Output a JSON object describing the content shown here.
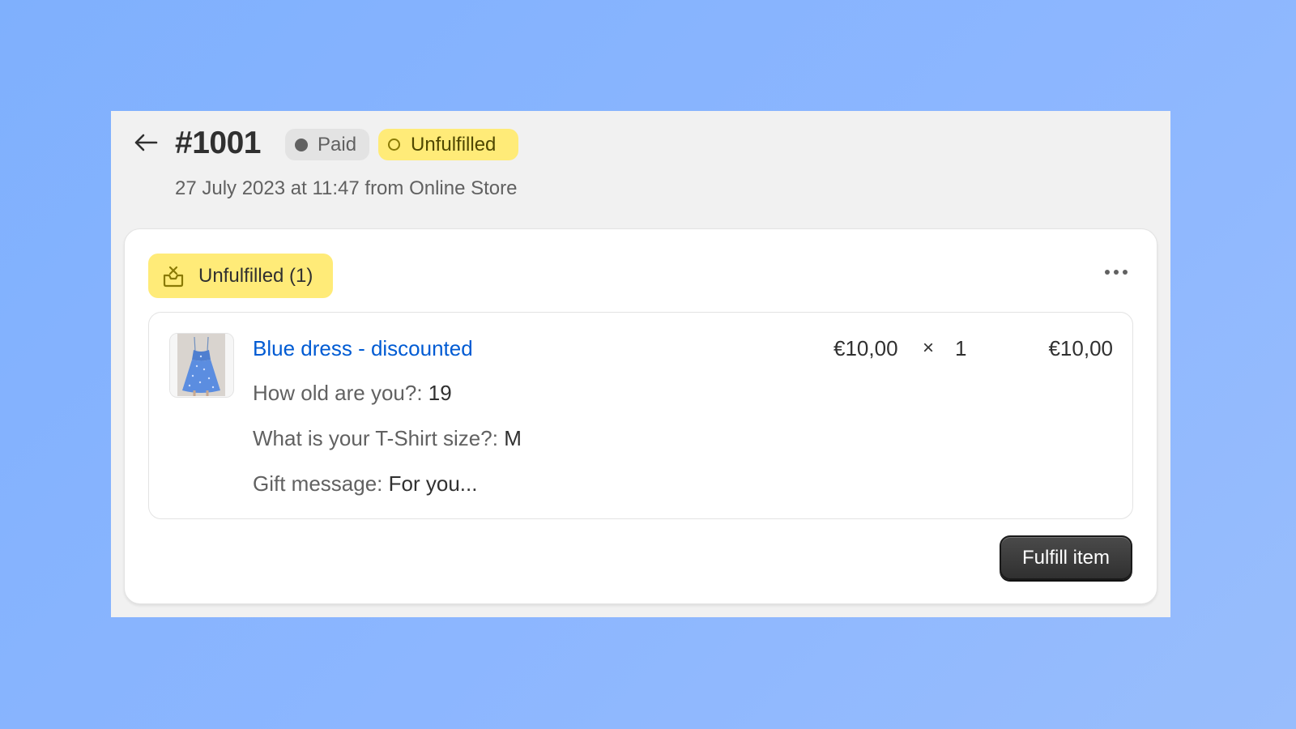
{
  "header": {
    "back_icon": "arrow-left-icon",
    "order_number": "#1001",
    "payment_badge": "Paid",
    "fulfillment_badge": "Unfulfilled",
    "subtitle": "27 July 2023 at 11:47 from Online Store"
  },
  "fulfillment_card": {
    "status_label": "Unfulfilled (1)",
    "status_icon": "package-icon",
    "more_icon": "more-horizontal-icon",
    "line_item": {
      "image_alt": "Blue dress",
      "product_name": "Blue dress - discounted",
      "unit_price": "€10,00",
      "multiply_sign": "×",
      "quantity": "1",
      "total": "€10,00",
      "properties": [
        {
          "key": "How old are you?:",
          "value": "19"
        },
        {
          "key": "What is your T-Shirt size?:",
          "value": "M"
        },
        {
          "key": "Gift message:",
          "value": "For you..."
        }
      ]
    },
    "fulfill_button": "Fulfill item"
  },
  "colors": {
    "background": "#8cb6ff",
    "panel": "#f1f1f1",
    "warning_badge": "#ffeb78",
    "link": "#005bd3",
    "primary_button": "#303030"
  }
}
